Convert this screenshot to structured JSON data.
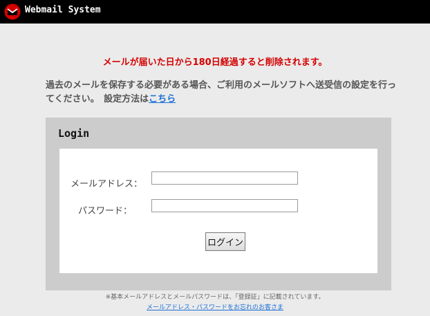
{
  "header": {
    "app_title": "Webmail System",
    "logo_icon": "envelope-logo-icon"
  },
  "notice": {
    "retention": "メールが届いた日から180日経過すると削除されます。",
    "backup_text": "過去のメールを保存する必要がある場合、ご利用のメールソフトへ送受信の設定を行ってください。　設定方法は",
    "backup_link": "こちら"
  },
  "login": {
    "title": "Login",
    "email_label": "メールアドレス：",
    "email_value": "",
    "password_label": "パスワード：",
    "password_value": "",
    "submit_label": "ログイン"
  },
  "footer": {
    "note": "※基本メールアドレスとメールパスワードは、「登録証」に記載されています。",
    "forgot_link": "メールアドレス・パスワードをお忘れのお客さま"
  },
  "colors": {
    "header_bg": "#000000",
    "page_bg": "#ebebeb",
    "notice_red": "#d40000",
    "link_blue": "#1a6fd6",
    "box_gray": "#cccccc"
  }
}
